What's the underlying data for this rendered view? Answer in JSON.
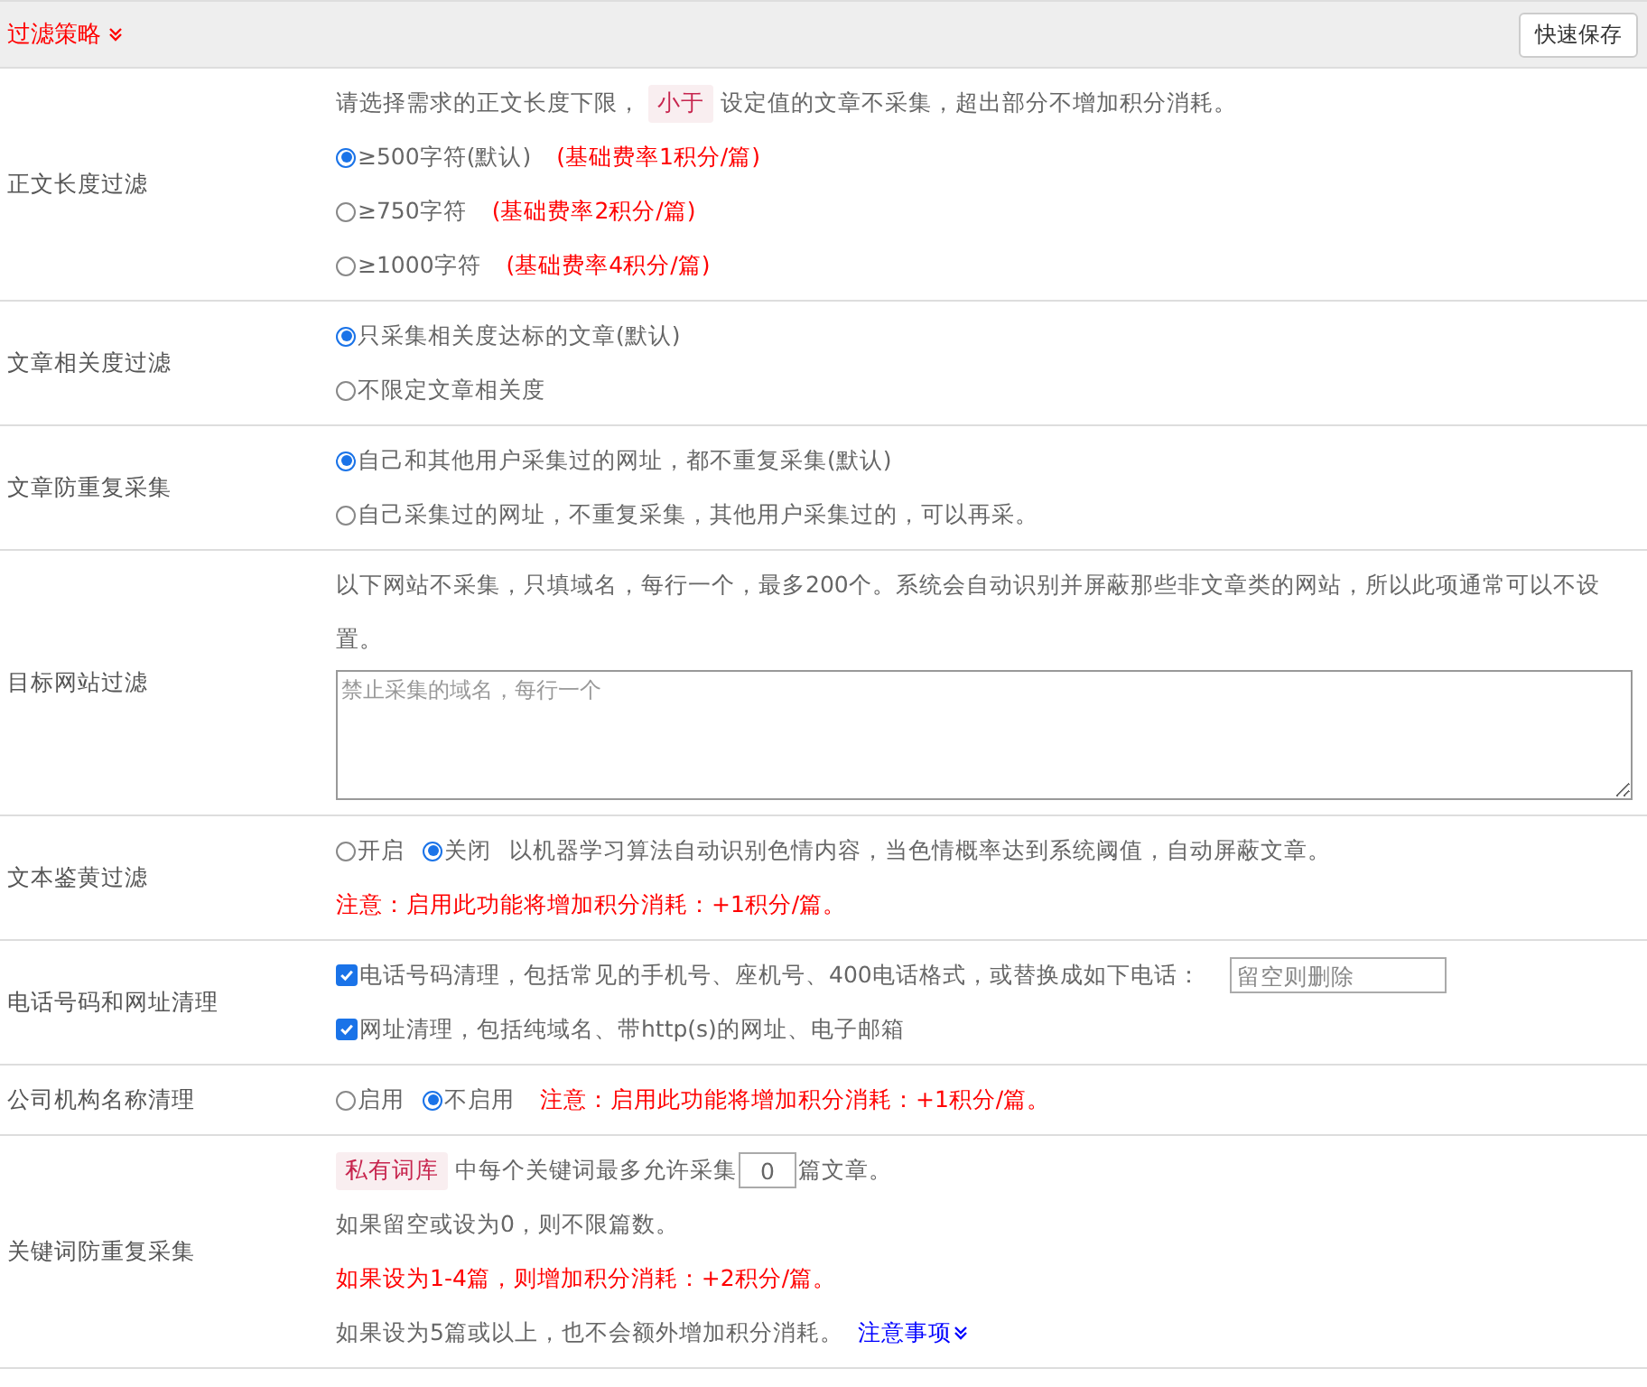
{
  "header": {
    "title": "过滤策略",
    "save_button": "快速保存"
  },
  "rows": [
    {
      "label": "正文长度过滤",
      "lines": [
        [
          {
            "kind": "text",
            "text": "请选择需求的正文长度下限，"
          },
          {
            "kind": "tag",
            "text": "小于"
          },
          {
            "kind": "text",
            "text": "设定值的文章不采集，超出部分不增加积分消耗。"
          }
        ],
        [
          {
            "kind": "radio",
            "label": "≥500字符(默认)",
            "selected": true
          },
          {
            "kind": "note",
            "text": "(基础费率1积分/篇)"
          }
        ],
        [
          {
            "kind": "radio",
            "label": "≥750字符",
            "selected": false
          },
          {
            "kind": "note",
            "text": "(基础费率2积分/篇)"
          }
        ],
        [
          {
            "kind": "radio",
            "label": "≥1000字符",
            "selected": false
          },
          {
            "kind": "note",
            "text": "(基础费率4积分/篇)"
          }
        ]
      ]
    },
    {
      "label": "文章相关度过滤",
      "lines": [
        [
          {
            "kind": "radio",
            "label": "只采集相关度达标的文章(默认)",
            "selected": true
          }
        ],
        [
          {
            "kind": "radio",
            "label": "不限定文章相关度",
            "selected": false
          }
        ]
      ]
    },
    {
      "label": "文章防重复采集",
      "lines": [
        [
          {
            "kind": "radio",
            "label": "自己和其他用户采集过的网址，都不重复采集(默认)",
            "selected": true
          }
        ],
        [
          {
            "kind": "radio",
            "label": "自己采集过的网址，不重复采集，其他用户采集过的，可以再采。",
            "selected": false
          }
        ]
      ]
    },
    {
      "label": "目标网站过滤",
      "lines": [
        [
          {
            "kind": "text",
            "text": "以下网站不采集，只填域名，每行一个，最多200个。系统会自动识别并屏蔽那些非文章类的网站，所以此项通常可以不设置。"
          }
        ],
        [
          {
            "kind": "textarea",
            "placeholder": "禁止采集的域名，每行一个"
          }
        ]
      ]
    },
    {
      "label": "文本鉴黄过滤",
      "lines": [
        [
          {
            "kind": "radio",
            "label": "开启",
            "selected": false
          },
          {
            "kind": "radio",
            "label": "关闭",
            "selected": true
          },
          {
            "kind": "text",
            "text": "以机器学习算法自动识别色情内容，当色情概率达到系统阈值，自动屏蔽文章。"
          }
        ],
        [
          {
            "kind": "note",
            "text": "注意：启用此功能将增加积分消耗：+1积分/篇。"
          }
        ]
      ]
    },
    {
      "label": "电话号码和网址清理",
      "lines": [
        [
          {
            "kind": "checkbox",
            "label": "电话号码清理，包括常见的手机号、座机号、400电话格式，或替换成如下电话：",
            "checked": true
          },
          {
            "kind": "input",
            "placeholder": "留空则删除"
          }
        ],
        [
          {
            "kind": "checkbox",
            "label": "网址清理，包括纯域名、带http(s)的网址、电子邮箱",
            "checked": true
          }
        ]
      ]
    },
    {
      "label": "公司机构名称清理",
      "lines": [
        [
          {
            "kind": "radio",
            "label": "启用",
            "selected": false
          },
          {
            "kind": "radio",
            "label": "不启用",
            "selected": true
          },
          {
            "kind": "note",
            "text": "注意：启用此功能将增加积分消耗：+1积分/篇。"
          }
        ]
      ]
    },
    {
      "label": "关键词防重复采集",
      "lines": [
        [
          {
            "kind": "tag",
            "text": "私有词库"
          },
          {
            "kind": "text",
            "text": "中每个关键词最多允许采集"
          },
          {
            "kind": "number",
            "value": "0"
          },
          {
            "kind": "text",
            "text": "篇文章。"
          }
        ],
        [
          {
            "kind": "text",
            "text": "如果留空或设为0，则不限篇数。"
          }
        ],
        [
          {
            "kind": "note",
            "text": "如果设为1-4篇，则增加积分消耗：+2积分/篇。"
          }
        ],
        [
          {
            "kind": "text",
            "text": "如果设为5篇或以上，也不会额外增加积分消耗。"
          },
          {
            "kind": "link",
            "text": "注意事项"
          }
        ]
      ]
    }
  ]
}
